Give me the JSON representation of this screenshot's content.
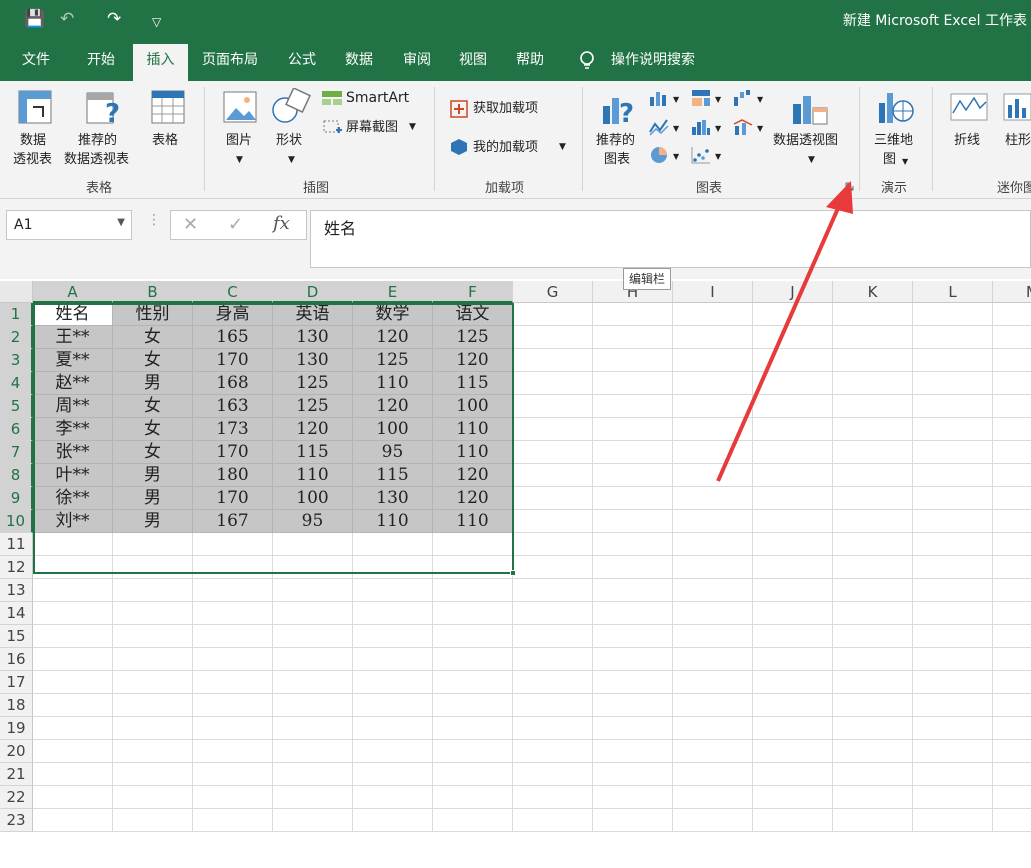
{
  "title": "新建 Microsoft Excel 工作表",
  "quick_access": {
    "save": "💾",
    "undo": "↶",
    "redo": "↷",
    "customize": "▽"
  },
  "tabs": [
    "文件",
    "开始",
    "插入",
    "页面布局",
    "公式",
    "数据",
    "审阅",
    "视图",
    "帮助"
  ],
  "active_tab": "插入",
  "tell_me": "操作说明搜索",
  "ribbon": {
    "tables": {
      "label": "表格",
      "pivot_line1": "数据",
      "pivot_line2": "透视表",
      "recommended_line1": "推荐的",
      "recommended_line2": "数据透视表",
      "table": "表格"
    },
    "illustrations": {
      "label": "插图",
      "picture": "图片",
      "shapes": "形状",
      "smartart": "SmartArt",
      "screenshot": "屏幕截图"
    },
    "addins": {
      "label": "加载项",
      "get_addins": "获取加载项",
      "my_addins": "我的加载项"
    },
    "charts": {
      "label": "图表",
      "recommended_line1": "推荐的",
      "recommended_line2": "图表",
      "pivot_chart": "数据透视图"
    },
    "tours": {
      "label": "演示",
      "map3d_line1": "三维地",
      "map3d_line2": "图"
    },
    "sparklines": {
      "label": "迷你图",
      "line": "折线",
      "column": "柱形"
    }
  },
  "name_box": "A1",
  "formula_value": "姓名",
  "tooltip": "编辑栏",
  "columns": [
    "A",
    "B",
    "C",
    "D",
    "E",
    "F",
    "G",
    "H",
    "I",
    "J",
    "K",
    "L",
    "M"
  ],
  "row_count": 23,
  "table": {
    "header": [
      "姓名",
      "性别",
      "身高",
      "英语",
      "数学",
      "语文"
    ],
    "rows": [
      [
        "王**",
        "女",
        "165",
        "130",
        "120",
        "125"
      ],
      [
        "夏**",
        "女",
        "170",
        "130",
        "125",
        "120"
      ],
      [
        "赵**",
        "男",
        "168",
        "125",
        "110",
        "115"
      ],
      [
        "周**",
        "女",
        "163",
        "125",
        "120",
        "100"
      ],
      [
        "李**",
        "女",
        "173",
        "120",
        "100",
        "110"
      ],
      [
        "张**",
        "女",
        "170",
        "115",
        "95",
        "110"
      ],
      [
        "叶**",
        "男",
        "180",
        "110",
        "115",
        "120"
      ],
      [
        "徐**",
        "男",
        "170",
        "100",
        "130",
        "120"
      ],
      [
        "刘**",
        "男",
        "167",
        "95",
        "110",
        "110"
      ]
    ]
  },
  "colors": {
    "accent": "#217346",
    "arrow": "#e83a3a"
  }
}
